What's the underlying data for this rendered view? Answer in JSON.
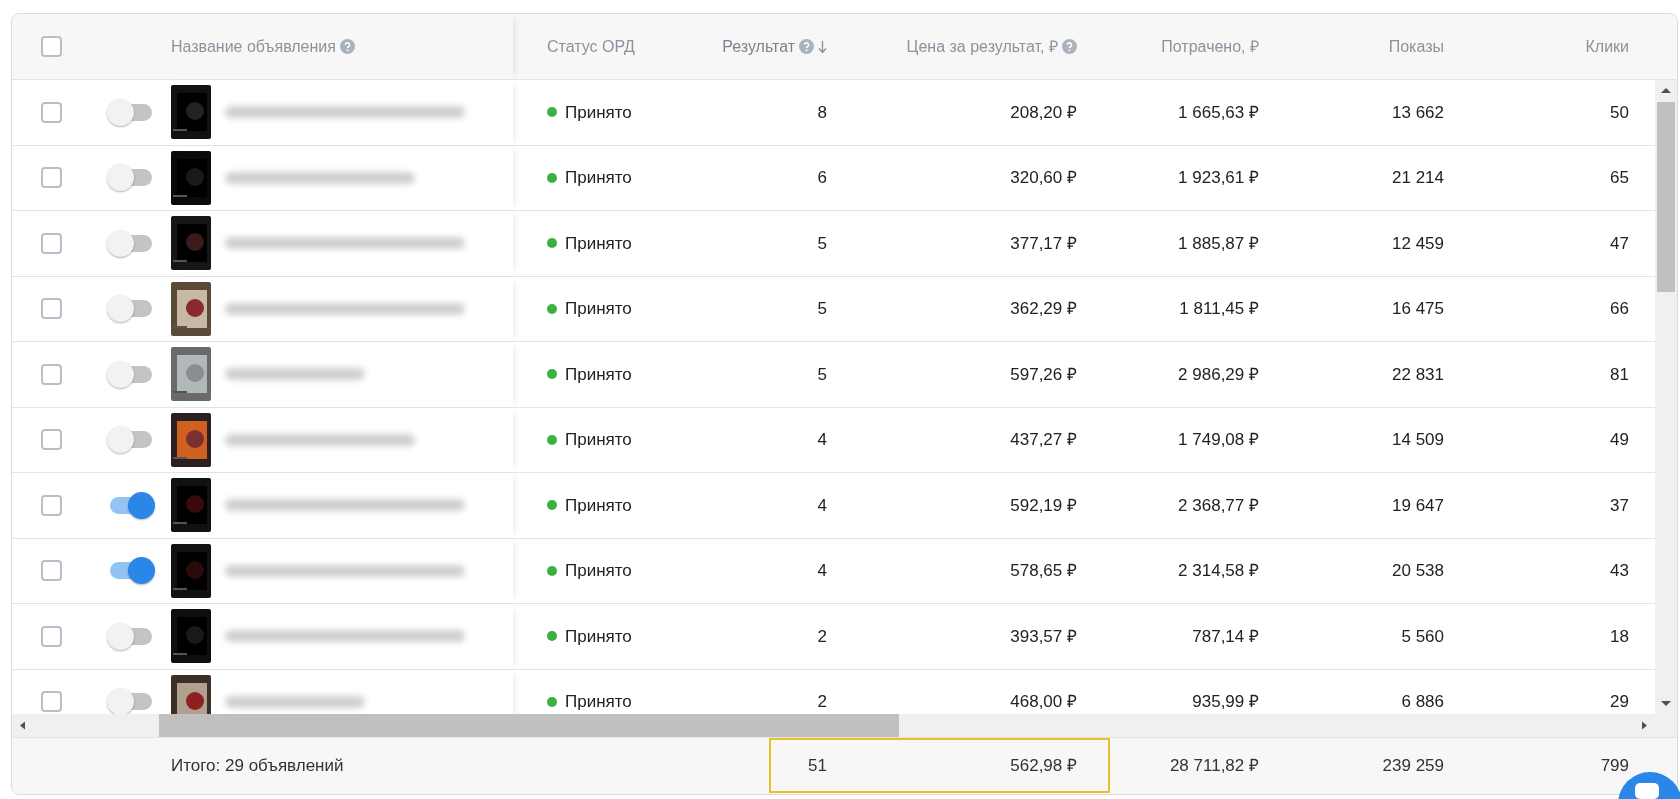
{
  "table": {
    "header": {
      "checked": false,
      "columns": [
        {
          "label": "Название объявления",
          "kind": "help",
          "sorted": false
        },
        {
          "label": "Статус ОРД",
          "kind": "plain",
          "sorted": false
        },
        {
          "label": "Результат",
          "kind": "help",
          "sorted": true
        },
        {
          "label": "Цена за результат, ₽",
          "kind": "help",
          "sorted": false
        },
        {
          "label": "Потрачено, ₽",
          "kind": "plain",
          "sorted": false
        },
        {
          "label": "Показы",
          "kind": "plain",
          "sorted": false
        },
        {
          "label": "Клики",
          "kind": "plain",
          "sorted": false
        }
      ]
    },
    "rows": [
      {
        "checked": false,
        "enabled": false,
        "status": "Принято",
        "result": "8",
        "cost_per_result": "208,20 ₽",
        "spent": "1 665,63 ₽",
        "impressions": "13 662",
        "clicks": "50"
      },
      {
        "checked": false,
        "enabled": false,
        "status": "Принято",
        "result": "6",
        "cost_per_result": "320,60 ₽",
        "spent": "1 923,61 ₽",
        "impressions": "21 214",
        "clicks": "65"
      },
      {
        "checked": false,
        "enabled": false,
        "status": "Принято",
        "result": "5",
        "cost_per_result": "377,17 ₽",
        "spent": "1 885,87 ₽",
        "impressions": "12 459",
        "clicks": "47"
      },
      {
        "checked": false,
        "enabled": false,
        "status": "Принято",
        "result": "5",
        "cost_per_result": "362,29 ₽",
        "spent": "1 811,45 ₽",
        "impressions": "16 475",
        "clicks": "66"
      },
      {
        "checked": false,
        "enabled": false,
        "status": "Принято",
        "result": "5",
        "cost_per_result": "597,26 ₽",
        "spent": "2 986,29 ₽",
        "impressions": "22 831",
        "clicks": "81"
      },
      {
        "checked": false,
        "enabled": false,
        "status": "Принято",
        "result": "4",
        "cost_per_result": "437,27 ₽",
        "spent": "1 749,08 ₽",
        "impressions": "14 509",
        "clicks": "49"
      },
      {
        "checked": false,
        "enabled": true,
        "status": "Принято",
        "result": "4",
        "cost_per_result": "592,19 ₽",
        "spent": "2 368,77 ₽",
        "impressions": "19 647",
        "clicks": "37"
      },
      {
        "checked": false,
        "enabled": true,
        "status": "Принято",
        "result": "4",
        "cost_per_result": "578,65 ₽",
        "spent": "2 314,58 ₽",
        "impressions": "20 538",
        "clicks": "43"
      },
      {
        "checked": false,
        "enabled": false,
        "status": "Принято",
        "result": "2",
        "cost_per_result": "393,57 ₽",
        "spent": "787,14 ₽",
        "impressions": "5 560",
        "clicks": "18"
      },
      {
        "checked": false,
        "enabled": false,
        "status": "Принято",
        "result": "2",
        "cost_per_result": "468,00 ₽",
        "spent": "935,99 ₽",
        "impressions": "6 886",
        "clicks": "29"
      }
    ],
    "footer": {
      "label": "Итого: 29 объявлений",
      "highlighted": true,
      "result": "51",
      "cost_per_result": "562,98 ₽",
      "spent": "28 711,82 ₽",
      "impressions": "239 259",
      "clicks": "799"
    }
  }
}
